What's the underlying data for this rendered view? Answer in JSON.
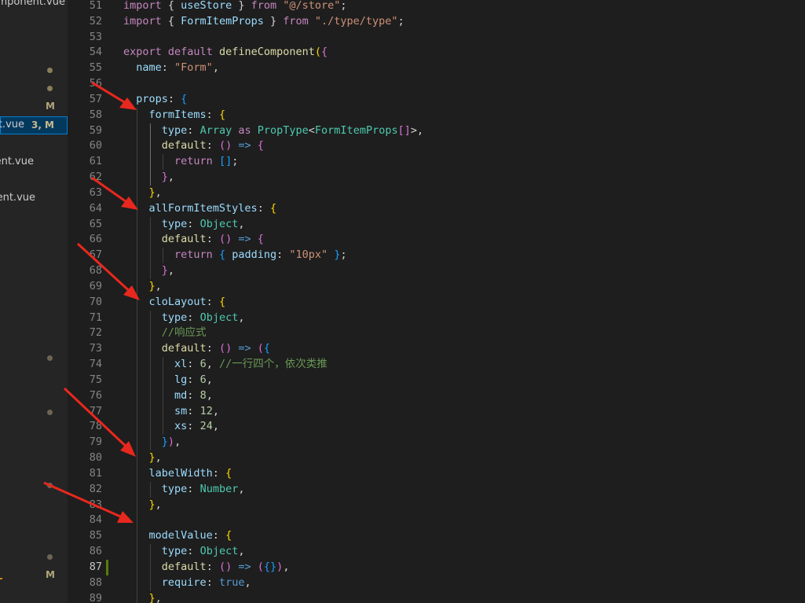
{
  "sidebar": {
    "items": [
      {
        "name": "omponent.vue",
        "badge": "",
        "selected": false
      },
      {
        "name": "ut.vue",
        "badge": "3, M",
        "selected": true
      },
      {
        "name": "ent.vue",
        "badge": "",
        "selected": false
      },
      {
        "name": "nent.vue",
        "badge": "",
        "selected": false
      }
    ],
    "git_letters": [
      "M",
      "M"
    ]
  },
  "editor": {
    "first_line_number": 51,
    "active_line": 87,
    "lines": [
      [
        [
          "kw",
          "import"
        ],
        [
          "pun",
          " { "
        ],
        [
          "var",
          "useStore"
        ],
        [
          "pun",
          " } "
        ],
        [
          "kw",
          "from"
        ],
        [
          "pun",
          " "
        ],
        [
          "str",
          "\"@/store\""
        ],
        [
          "pun",
          ";"
        ]
      ],
      [
        [
          "kw",
          "import"
        ],
        [
          "pun",
          " { "
        ],
        [
          "var",
          "FormItemProps"
        ],
        [
          "pun",
          " } "
        ],
        [
          "kw",
          "from"
        ],
        [
          "pun",
          " "
        ],
        [
          "str",
          "\"./type/type\""
        ],
        [
          "pun",
          ";"
        ]
      ],
      [],
      [
        [
          "kw",
          "export"
        ],
        [
          "pun",
          " "
        ],
        [
          "kw",
          "default"
        ],
        [
          "pun",
          " "
        ],
        [
          "fn",
          "defineComponent"
        ],
        [
          "p1",
          "("
        ],
        [
          "p2",
          "{"
        ]
      ],
      [
        [
          "pun",
          "  "
        ],
        [
          "var",
          "name"
        ],
        [
          "pun",
          ": "
        ],
        [
          "str",
          "\"Form\""
        ],
        [
          "pun",
          ","
        ]
      ],
      [],
      [
        [
          "pun",
          "  "
        ],
        [
          "var",
          "props"
        ],
        [
          "pun",
          ": "
        ],
        [
          "p3",
          "{"
        ]
      ],
      [
        [
          "pun",
          "    "
        ],
        [
          "var",
          "formItems"
        ],
        [
          "pun",
          ": "
        ],
        [
          "p1",
          "{"
        ]
      ],
      [
        [
          "pun",
          "      "
        ],
        [
          "var",
          "type"
        ],
        [
          "pun",
          ": "
        ],
        [
          "typ",
          "Array"
        ],
        [
          "pun",
          " "
        ],
        [
          "kw",
          "as"
        ],
        [
          "pun",
          " "
        ],
        [
          "typ",
          "PropType"
        ],
        [
          "pun",
          "<"
        ],
        [
          "typ",
          "FormItemProps"
        ],
        [
          "p2",
          "[]"
        ],
        [
          "pun",
          ">,"
        ]
      ],
      [
        [
          "pun",
          "      "
        ],
        [
          "fn",
          "default"
        ],
        [
          "pun",
          ": "
        ],
        [
          "p2",
          "()"
        ],
        [
          "pun",
          " "
        ],
        [
          "kb",
          "=>"
        ],
        [
          "pun",
          " "
        ],
        [
          "p2",
          "{"
        ]
      ],
      [
        [
          "pun",
          "        "
        ],
        [
          "kw",
          "return"
        ],
        [
          "pun",
          " "
        ],
        [
          "p3",
          "[]"
        ],
        [
          "pun",
          ";"
        ]
      ],
      [
        [
          "pun",
          "      "
        ],
        [
          "p2",
          "}"
        ],
        [
          "pun",
          ","
        ]
      ],
      [
        [
          "pun",
          "    "
        ],
        [
          "p1",
          "}"
        ],
        [
          "pun",
          ","
        ]
      ],
      [
        [
          "pun",
          "    "
        ],
        [
          "var",
          "allFormItemStyles"
        ],
        [
          "pun",
          ": "
        ],
        [
          "p1",
          "{"
        ]
      ],
      [
        [
          "pun",
          "      "
        ],
        [
          "var",
          "type"
        ],
        [
          "pun",
          ": "
        ],
        [
          "typ",
          "Object"
        ],
        [
          "pun",
          ","
        ]
      ],
      [
        [
          "pun",
          "      "
        ],
        [
          "fn",
          "default"
        ],
        [
          "pun",
          ": "
        ],
        [
          "p2",
          "()"
        ],
        [
          "pun",
          " "
        ],
        [
          "kb",
          "=>"
        ],
        [
          "pun",
          " "
        ],
        [
          "p2",
          "{"
        ]
      ],
      [
        [
          "pun",
          "        "
        ],
        [
          "kw",
          "return"
        ],
        [
          "pun",
          " "
        ],
        [
          "p3",
          "{"
        ],
        [
          "pun",
          " "
        ],
        [
          "var",
          "padding"
        ],
        [
          "pun",
          ": "
        ],
        [
          "str",
          "\"10px\""
        ],
        [
          "pun",
          " "
        ],
        [
          "p3",
          "}"
        ],
        [
          "pun",
          ";"
        ]
      ],
      [
        [
          "pun",
          "      "
        ],
        [
          "p2",
          "}"
        ],
        [
          "pun",
          ","
        ]
      ],
      [
        [
          "pun",
          "    "
        ],
        [
          "p1",
          "}"
        ],
        [
          "pun",
          ","
        ]
      ],
      [
        [
          "pun",
          "    "
        ],
        [
          "var",
          "cloLayout"
        ],
        [
          "pun",
          ": "
        ],
        [
          "p1",
          "{"
        ]
      ],
      [
        [
          "pun",
          "      "
        ],
        [
          "var",
          "type"
        ],
        [
          "pun",
          ": "
        ],
        [
          "typ",
          "Object"
        ],
        [
          "pun",
          ","
        ]
      ],
      [
        [
          "pun",
          "      "
        ],
        [
          "cmt",
          "//响应式"
        ]
      ],
      [
        [
          "pun",
          "      "
        ],
        [
          "fn",
          "default"
        ],
        [
          "pun",
          ": "
        ],
        [
          "p2",
          "()"
        ],
        [
          "pun",
          " "
        ],
        [
          "kb",
          "=>"
        ],
        [
          "pun",
          " "
        ],
        [
          "p2",
          "("
        ],
        [
          "p3",
          "{"
        ]
      ],
      [
        [
          "pun",
          "        "
        ],
        [
          "var",
          "xl"
        ],
        [
          "pun",
          ": "
        ],
        [
          "num",
          "6"
        ],
        [
          "pun",
          ", "
        ],
        [
          "cmt",
          "//一行四个，依次类推"
        ]
      ],
      [
        [
          "pun",
          "        "
        ],
        [
          "var",
          "lg"
        ],
        [
          "pun",
          ": "
        ],
        [
          "num",
          "6"
        ],
        [
          "pun",
          ","
        ]
      ],
      [
        [
          "pun",
          "        "
        ],
        [
          "var",
          "md"
        ],
        [
          "pun",
          ": "
        ],
        [
          "num",
          "8"
        ],
        [
          "pun",
          ","
        ]
      ],
      [
        [
          "pun",
          "        "
        ],
        [
          "var",
          "sm"
        ],
        [
          "pun",
          ": "
        ],
        [
          "num",
          "12"
        ],
        [
          "pun",
          ","
        ]
      ],
      [
        [
          "pun",
          "        "
        ],
        [
          "var",
          "xs"
        ],
        [
          "pun",
          ": "
        ],
        [
          "num",
          "24"
        ],
        [
          "pun",
          ","
        ]
      ],
      [
        [
          "pun",
          "      "
        ],
        [
          "p3",
          "}"
        ],
        [
          "p2",
          ")"
        ],
        [
          "pun",
          ","
        ]
      ],
      [
        [
          "pun",
          "    "
        ],
        [
          "p1",
          "}"
        ],
        [
          "pun",
          ","
        ]
      ],
      [
        [
          "pun",
          "    "
        ],
        [
          "var",
          "labelWidth"
        ],
        [
          "pun",
          ": "
        ],
        [
          "p1",
          "{"
        ]
      ],
      [
        [
          "pun",
          "      "
        ],
        [
          "var",
          "type"
        ],
        [
          "pun",
          ": "
        ],
        [
          "typ",
          "Number"
        ],
        [
          "pun",
          ","
        ]
      ],
      [
        [
          "pun",
          "    "
        ],
        [
          "p1",
          "}"
        ],
        [
          "pun",
          ","
        ]
      ],
      [],
      [
        [
          "pun",
          "    "
        ],
        [
          "var",
          "modelValue"
        ],
        [
          "pun",
          ": "
        ],
        [
          "p1",
          "{"
        ]
      ],
      [
        [
          "pun",
          "      "
        ],
        [
          "var",
          "type"
        ],
        [
          "pun",
          ": "
        ],
        [
          "typ",
          "Object"
        ],
        [
          "pun",
          ","
        ]
      ],
      [
        [
          "pun",
          "      "
        ],
        [
          "fn",
          "default"
        ],
        [
          "pun",
          ": "
        ],
        [
          "p2",
          "()"
        ],
        [
          "pun",
          " "
        ],
        [
          "kb",
          "=>"
        ],
        [
          "pun",
          " "
        ],
        [
          "p2",
          "("
        ],
        [
          "p3",
          "{}"
        ],
        [
          "p2",
          ")"
        ],
        [
          "pun",
          ","
        ]
      ],
      [
        [
          "pun",
          "      "
        ],
        [
          "var",
          "require"
        ],
        [
          "pun",
          ": "
        ],
        [
          "kb",
          "true"
        ],
        [
          "pun",
          ","
        ]
      ],
      [
        [
          "pun",
          "    "
        ],
        [
          "p1",
          "}"
        ],
        [
          "pun",
          ","
        ]
      ],
      [
        [
          "pun",
          "  "
        ],
        [
          "p3",
          "}"
        ],
        [
          "pun",
          ","
        ]
      ]
    ]
  },
  "colors": {
    "editor_background": "#1e1e1e",
    "sidebar_background": "#252526",
    "selection": "#04395e",
    "annotation_arrow": "#e8281e",
    "git_modified": "#587c0c"
  }
}
